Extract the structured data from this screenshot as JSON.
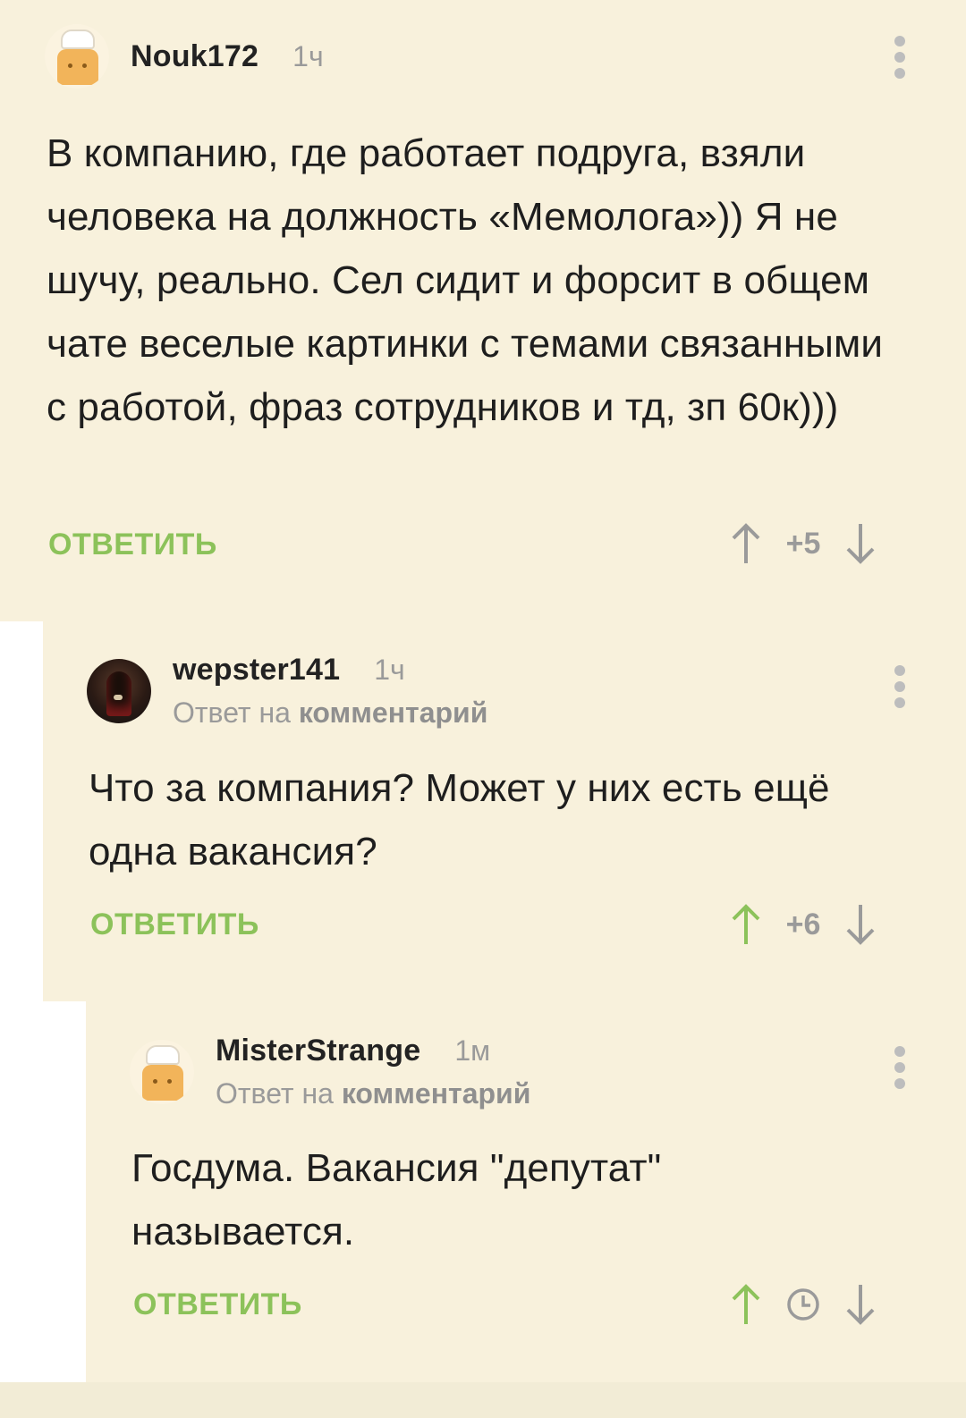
{
  "comments": [
    {
      "username": "Nouk172",
      "time": "1ч",
      "avatar": "chef-avatar",
      "text": "В компанию, где работает подруга, взяли человека на должность «Мемолога»)) Я не шучу, реально. Сел сидит и форсит в общем чате веселые картинки с темами связанными с работой, фраз сотрудников и тд, зп 60к)))",
      "reply_label": "ОТВЕТИТЬ",
      "score": "+5"
    },
    {
      "username": "wepster141",
      "time": "1ч",
      "reply_prefix": "Ответ на",
      "reply_target": "комментарий",
      "avatar": "dark-avatar",
      "text": "Что за компания? Может у них есть ещё одна вакансия?",
      "reply_label": "ОТВЕТИТЬ",
      "score": "+6"
    },
    {
      "username": "MisterStrange",
      "time": "1м",
      "reply_prefix": "Ответ на",
      "reply_target": "комментарий",
      "avatar": "chef-avatar",
      "text": "Госдума. Вакансия \"депутат\" называется.",
      "reply_label": "ОТВЕТИТЬ",
      "score_icon": "clock-icon"
    }
  ],
  "colors": {
    "accent_green": "#8cc25a",
    "comment_bg": "#f8f1dc",
    "muted": "#9a9a9a"
  }
}
